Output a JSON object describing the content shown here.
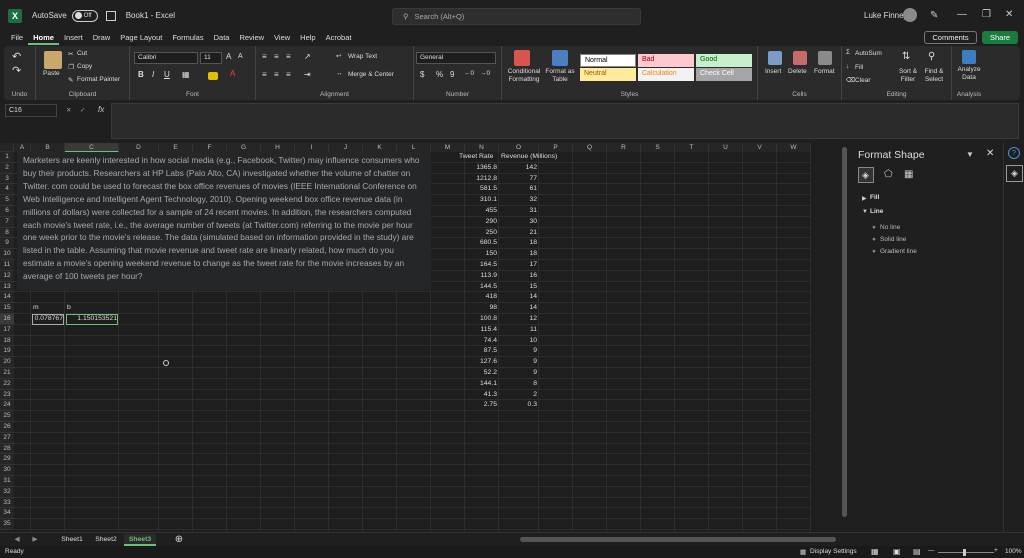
{
  "titlebar": {
    "logo": "X",
    "autosave_label": "AutoSave",
    "autosave_state": "Off",
    "doc_title": "Book1  -  Excel",
    "search_placeholder": "Search (Alt+Q)",
    "user_name": "Luke Finney"
  },
  "menu": {
    "tabs": [
      "File",
      "Home",
      "Insert",
      "Draw",
      "Page Layout",
      "Formulas",
      "Data",
      "Review",
      "View",
      "Help",
      "Acrobat"
    ],
    "active": "Home",
    "comments": "Comments",
    "share": "Share"
  },
  "ribbon": {
    "undo": "Undo",
    "clipboard": {
      "label": "Clipboard",
      "paste": "Paste",
      "cut": "Cut",
      "copy": "Copy",
      "format_painter": "Format Painter"
    },
    "font": {
      "label": "Font",
      "name": "Calibri",
      "size": "11"
    },
    "alignment": {
      "label": "Alignment",
      "wrap": "Wrap Text",
      "merge": "Merge & Center"
    },
    "number": {
      "label": "Number",
      "format": "General"
    },
    "styles": {
      "label": "Styles",
      "conditional": "Conditional Formatting",
      "format_table": "Format as Table",
      "cells": [
        {
          "name": "Normal",
          "bg": "#ffffff",
          "fg": "#000000"
        },
        {
          "name": "Bad",
          "bg": "#ffc7ce",
          "fg": "#9c0006"
        },
        {
          "name": "Good",
          "bg": "#c6efce",
          "fg": "#006100"
        },
        {
          "name": "Neutral",
          "bg": "#ffeb9c",
          "fg": "#9c5700"
        },
        {
          "name": "Calculation",
          "bg": "#f2f2f2",
          "fg": "#fa7d00"
        },
        {
          "name": "Check Cell",
          "bg": "#a5a5a5",
          "fg": "#ffffff"
        }
      ]
    },
    "cells": {
      "label": "Cells",
      "insert": "Insert",
      "delete": "Delete",
      "format": "Format"
    },
    "editing": {
      "label": "Editing",
      "autosum": "AutoSum",
      "fill": "Fill",
      "clear": "Clear",
      "sort": "Sort & Filter",
      "find": "Find & Select"
    },
    "analysis": {
      "label": "Analysis",
      "analyze": "Analyze Data"
    }
  },
  "formula_bar": {
    "name_box": "C16",
    "fx": "fx",
    "content": ""
  },
  "columns": [
    "A",
    "B",
    "C",
    "D",
    "E",
    "F",
    "G",
    "H",
    "I",
    "J",
    "K",
    "L",
    "M",
    "N",
    "O",
    "P",
    "Q",
    "R",
    "S",
    "T",
    "U",
    "V",
    "W"
  ],
  "rows": [
    "1",
    "2",
    "3",
    "4",
    "5",
    "6",
    "7",
    "8",
    "9",
    "10",
    "11",
    "12",
    "13",
    "14",
    "15",
    "16",
    "17",
    "18",
    "19",
    "20",
    "21",
    "22",
    "23",
    "24",
    "25",
    "26",
    "27",
    "28",
    "29",
    "30",
    "31",
    "32",
    "33",
    "34",
    "35"
  ],
  "textbox": "Marketers are keenly interested in how social media (e.g., Facebook, Twitter) may influence consumers who buy their products. Researchers at HP Labs (Palo Alto, CA) investigated whether the volume of chatter on Twitter. com could be used to forecast the box office revenues of movies (IEEE International Conference on Web Intelligence and Intelligent Agent Technology, 2010). Opening weekend box office revenue data (in millions of dollars) were collected for a sample of 24 recent movies. In addition, the researchers computed each movie's tweet rate, i.e., the average number of tweets (at Twitter.com) referring to the movie per hour one week prior to the movie's release. The data (simulated based on information provided in the study) are listed in the table. Assuming that movie revenue and tweet rate are linearly related, how much do you estimate a movie's opening weekend revenue to change as the tweet rate for the movie increases by an average of 100 tweets per hour?",
  "labels": {
    "m": "m",
    "b": "b",
    "m_value": "0.078767",
    "b_value": "1.150153521"
  },
  "table": {
    "header_tweet": "Tweet Rate",
    "header_revenue": "Revenue (Millions)",
    "rows": [
      [
        "1365.8",
        "142"
      ],
      [
        "1212.8",
        "77"
      ],
      [
        "581.5",
        "61"
      ],
      [
        "310.1",
        "32"
      ],
      [
        "455",
        "31"
      ],
      [
        "290",
        "30"
      ],
      [
        "250",
        "21"
      ],
      [
        "680.5",
        "18"
      ],
      [
        "150",
        "18"
      ],
      [
        "164.5",
        "17"
      ],
      [
        "113.9",
        "16"
      ],
      [
        "144.5",
        "15"
      ],
      [
        "418",
        "14"
      ],
      [
        "98",
        "14"
      ],
      [
        "100.8",
        "12"
      ],
      [
        "115.4",
        "11"
      ],
      [
        "74.4",
        "10"
      ],
      [
        "87.5",
        "9"
      ],
      [
        "127.6",
        "9"
      ],
      [
        "52.2",
        "9"
      ],
      [
        "144.1",
        "8"
      ],
      [
        "41.3",
        "2"
      ],
      [
        "2.75",
        "0.3"
      ]
    ]
  },
  "format_pane": {
    "title": "Format Shape",
    "fill": "Fill",
    "line": "Line",
    "options": [
      "No line",
      "Solid line",
      "Gradient line"
    ]
  },
  "sheets": {
    "tabs": [
      "Sheet1",
      "Sheet2",
      "Sheet3"
    ],
    "active": "Sheet3"
  },
  "status": {
    "ready": "Ready",
    "display": "Display Settings",
    "zoom": "100%"
  }
}
